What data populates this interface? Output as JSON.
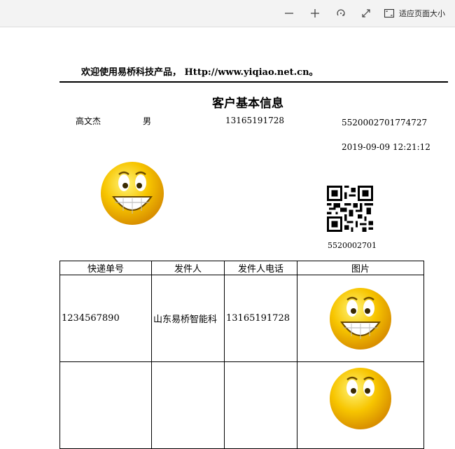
{
  "toolbar": {
    "zoom_out_icon": "minus-icon",
    "zoom_in_icon": "plus-icon",
    "rotate_icon": "rotate-icon",
    "fullscreen_icon": "expand-icon",
    "fit_icon": "fit-page-icon",
    "fit_label": "适应页面大小"
  },
  "report": {
    "welcome": "欢迎使用易桥科技产品， Http://www.yiqiao.net.cn。",
    "title": "客户基本信息",
    "name": "高文杰",
    "gender": "男",
    "phone": "13165191728",
    "customer_id": "5520002701774727",
    "datetime": "2019-09-09 12:21:12",
    "qr_number": "5520002701"
  },
  "table": {
    "headers": [
      "快递单号",
      "发件人",
      "发件人电话",
      "图片"
    ],
    "rows": [
      {
        "tracking": "1234567890",
        "sender": "山东易桥智能科",
        "phone": "13165191728"
      },
      {
        "tracking": "",
        "sender": "",
        "phone": ""
      }
    ]
  },
  "colors": {
    "toolbar_bg": "#f3f3f3",
    "smiley_face": "#f7c500",
    "smiley_edge": "#e0a000"
  }
}
